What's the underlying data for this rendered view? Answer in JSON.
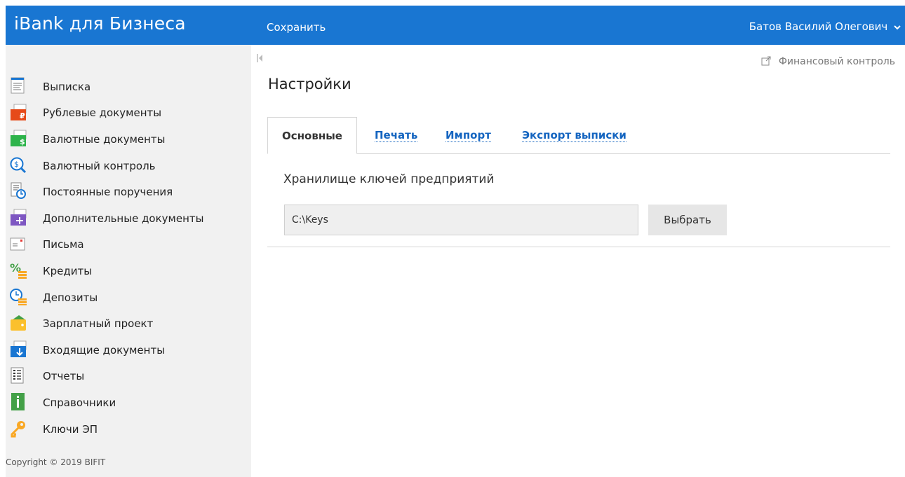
{
  "header": {
    "brand": "iBank для Бизнеса",
    "save_label": "Сохранить",
    "user_name": "Батов Василий Олегович"
  },
  "sidebar": {
    "items": [
      {
        "label": "Выписка",
        "icon": "statement-icon"
      },
      {
        "label": "Рублевые документы",
        "icon": "ruble-documents-icon"
      },
      {
        "label": "Валютные документы",
        "icon": "currency-documents-icon"
      },
      {
        "label": "Валютный контроль",
        "icon": "currency-control-icon"
      },
      {
        "label": "Постоянные поручения",
        "icon": "standing-orders-icon"
      },
      {
        "label": "Дополнительные документы",
        "icon": "additional-documents-icon"
      },
      {
        "label": "Письма",
        "icon": "letters-icon"
      },
      {
        "label": "Кредиты",
        "icon": "credits-icon"
      },
      {
        "label": "Депозиты",
        "icon": "deposits-icon"
      },
      {
        "label": "Зарплатный проект",
        "icon": "salary-project-icon"
      },
      {
        "label": "Входящие документы",
        "icon": "incoming-documents-icon"
      },
      {
        "label": "Отчеты",
        "icon": "reports-icon"
      },
      {
        "label": "Справочники",
        "icon": "directories-icon"
      },
      {
        "label": "Ключи ЭП",
        "icon": "signature-keys-icon"
      }
    ],
    "copyright": "Copyright © 2019 BIFIT"
  },
  "main": {
    "financial_control": "Финансовый контроль",
    "title": "Настройки",
    "tabs": [
      {
        "label": "Основные",
        "active": true
      },
      {
        "label": "Печать",
        "active": false
      },
      {
        "label": "Импорт",
        "active": false
      },
      {
        "label": "Экспорт выписки",
        "active": false
      }
    ],
    "key_storage_label": "Хранилище ключей предприятий",
    "key_storage_path": "C:\\Keys",
    "choose_label": "Выбрать"
  },
  "colors": {
    "header_bg": "#1976d2",
    "sidebar_bg": "#f1f1f1",
    "link": "#1565c0"
  }
}
